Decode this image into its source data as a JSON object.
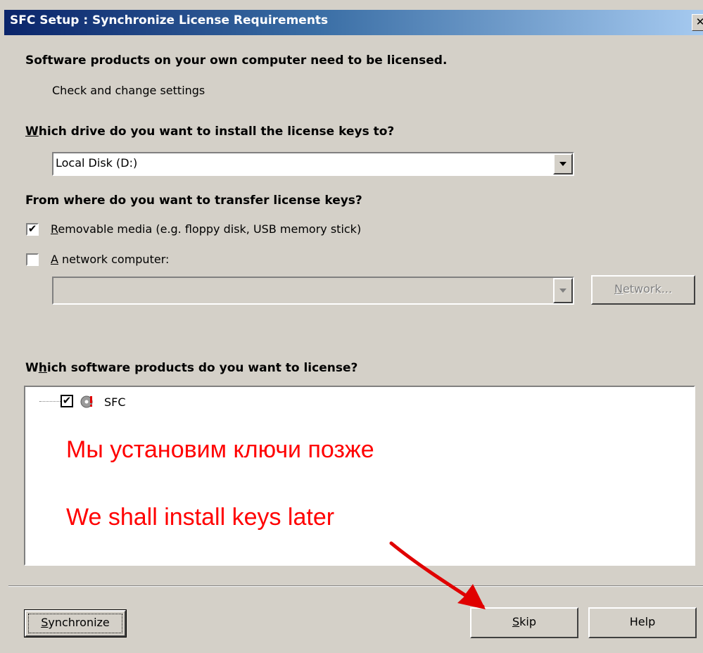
{
  "window": {
    "title": "SFC Setup : Synchronize License Requirements",
    "close_glyph": "✕"
  },
  "header": {
    "heading": "Software products on your own computer need to be licensed.",
    "subheading": "Check and change settings"
  },
  "drive": {
    "question_accel": "W",
    "question_rest": "hich drive do you want to install the license keys to?",
    "selected": "Local Disk (D:)"
  },
  "source": {
    "question": "From where do you want to transfer license keys?",
    "removable_accel": "R",
    "removable_rest": "emovable media (e.g. floppy disk, USB memory stick)",
    "removable_checked": true,
    "network_accel": "A",
    "network_rest": " network computer:",
    "network_checked": false,
    "network_value": "",
    "network_button_accel": "N",
    "network_button_rest": "etwork..."
  },
  "products": {
    "question_pre": "W",
    "question_accel": "h",
    "question_rest": "ich software products do you want to license?",
    "items": [
      {
        "label": "SFC",
        "checked": true
      }
    ]
  },
  "annotation": {
    "russian": "Мы установим ключи позже",
    "english": "We shall install keys later",
    "color": "#ff0000"
  },
  "footer": {
    "synchronize_accel": "S",
    "synchronize_rest": "ynchronize",
    "skip_accel": "S",
    "skip_rest": "kip",
    "help_label": "Help"
  },
  "icons": {
    "check_glyph": "✔",
    "product_icon": "disc-warning-icon",
    "dropdown_icon": "chevron-down-icon",
    "arrow": "red-arrow-icon"
  }
}
